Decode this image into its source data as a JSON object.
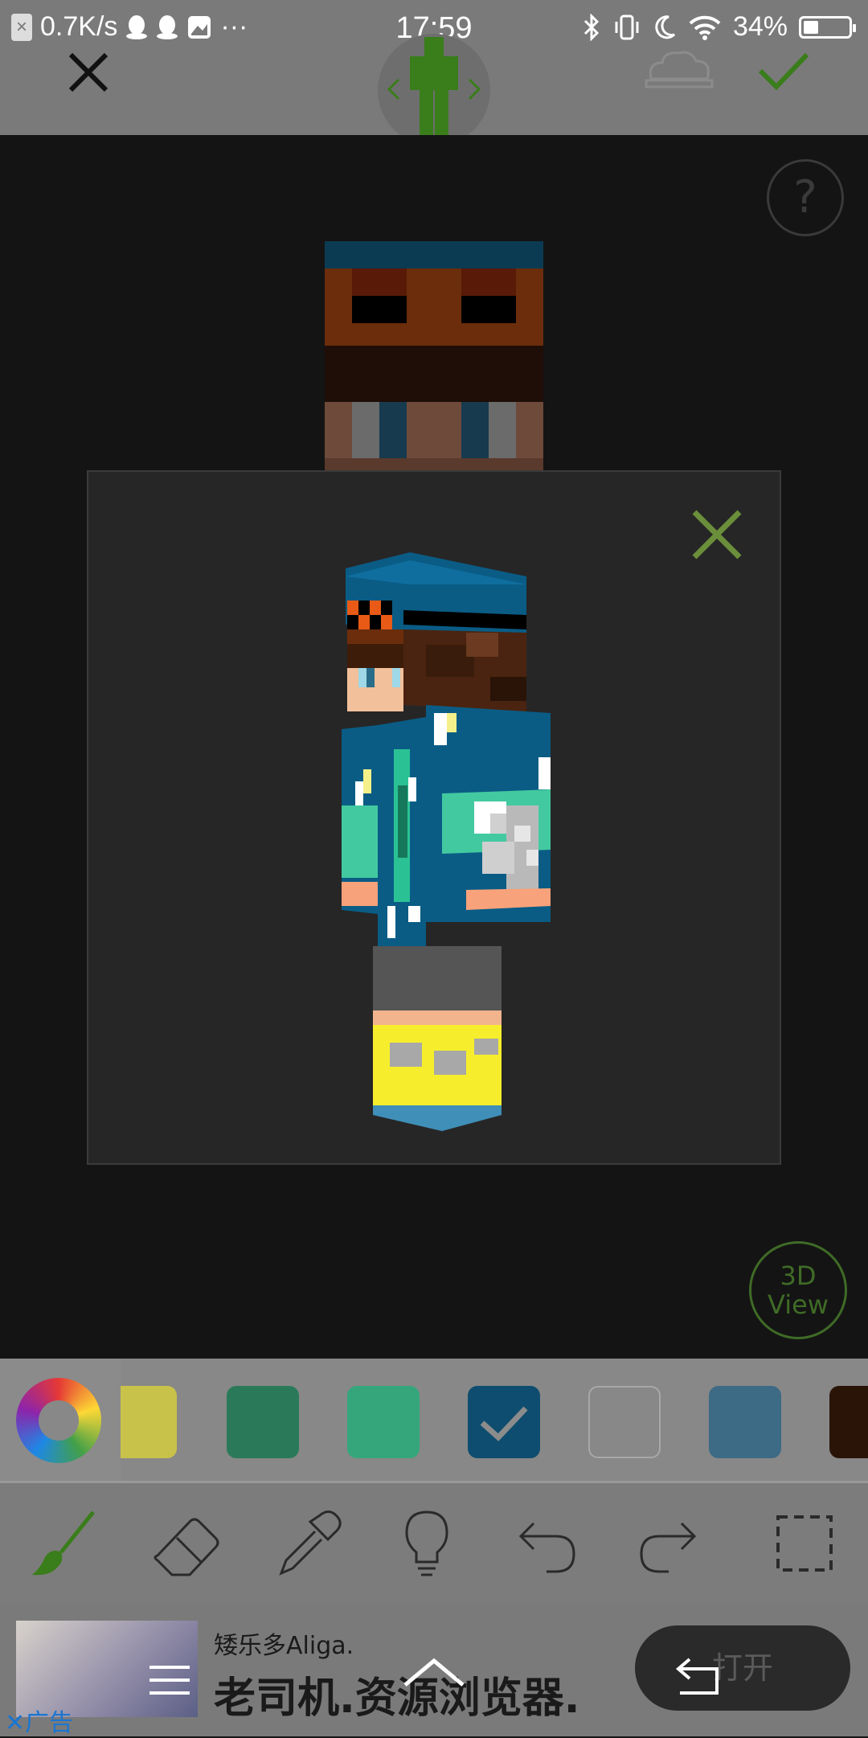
{
  "status_bar": {
    "speed": "0.7K/s",
    "dots": "···",
    "time": "17:59",
    "battery": "34%",
    "battery_level": 0.34
  },
  "canvas": {
    "help": "?",
    "view3d_line1": "3D",
    "view3d_line2": "View"
  },
  "palette": {
    "colors": [
      "#c9c24a",
      "#2a7a5a",
      "#35a67c",
      "#0e4d6f",
      "#8a8a8a",
      "#3d6a85",
      "#2a1408"
    ],
    "selected_index": 3
  },
  "tools": [
    "brush",
    "eraser",
    "eyedropper",
    "lightbulb",
    "undo",
    "redo",
    "select"
  ],
  "ad": {
    "label": "广告",
    "title": "矮乐多Aliga.",
    "headline": "老司机.资源浏览器.",
    "open_button": "打开"
  },
  "colors": {
    "accent_green": "#3a7d1b",
    "modal_close": "#6b8e3a"
  }
}
